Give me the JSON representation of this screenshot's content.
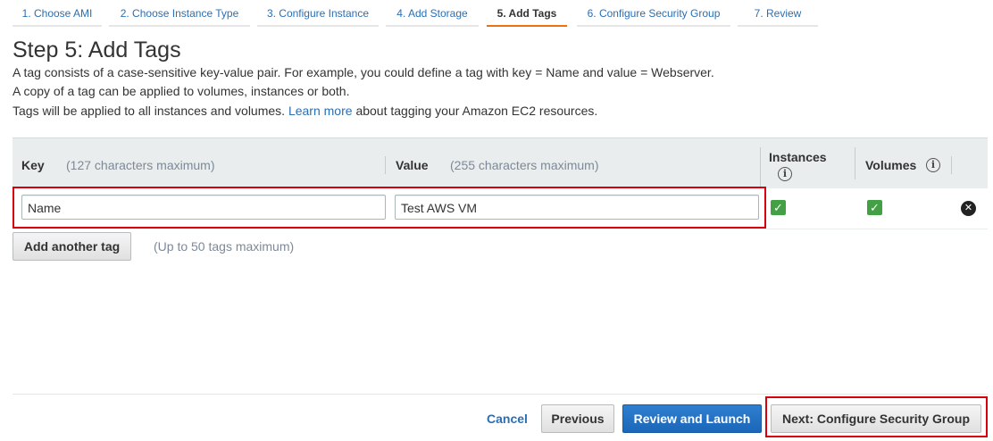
{
  "wizard": {
    "steps": [
      {
        "label": "1. Choose AMI"
      },
      {
        "label": "2. Choose Instance Type"
      },
      {
        "label": "3. Configure Instance"
      },
      {
        "label": "4. Add Storage"
      },
      {
        "label": "5. Add Tags",
        "active": true
      },
      {
        "label": "6. Configure Security Group"
      },
      {
        "label": "7. Review"
      }
    ]
  },
  "page": {
    "title": "Step 5: Add Tags",
    "desc_line1": "A tag consists of a case-sensitive key-value pair. For example, you could define a tag with key = Name and value = Webserver.",
    "desc_line2": "A copy of a tag can be applied to volumes, instances or both.",
    "desc_line3_pre": "Tags will be applied to all instances and volumes.",
    "desc_link": "Learn more",
    "desc_line3_post": "about tagging your Amazon EC2 resources."
  },
  "table": {
    "headers": {
      "key": "Key",
      "key_hint": "(127 characters maximum)",
      "value": "Value",
      "value_hint": "(255 characters maximum)",
      "instances": "Instances",
      "volumes": "Volumes"
    },
    "rows": [
      {
        "key": "Name",
        "value": "Test AWS VM",
        "instances": true,
        "volumes": true
      }
    ]
  },
  "add_tag": {
    "label": "Add another tag",
    "hint": "(Up to 50 tags maximum)"
  },
  "footer": {
    "cancel": "Cancel",
    "previous": "Previous",
    "review_launch": "Review and Launch",
    "next": "Next: Configure Security Group"
  },
  "icons": {
    "info": "info-icon",
    "check": "checkbox-checked-icon",
    "remove": "remove-circle-icon"
  },
  "colors": {
    "active_step_underline": "#ec7211",
    "link": "#2b6fb3",
    "primary_button": "#1b66b8",
    "highlight": "#d9000d",
    "checkbox": "#44a044"
  }
}
